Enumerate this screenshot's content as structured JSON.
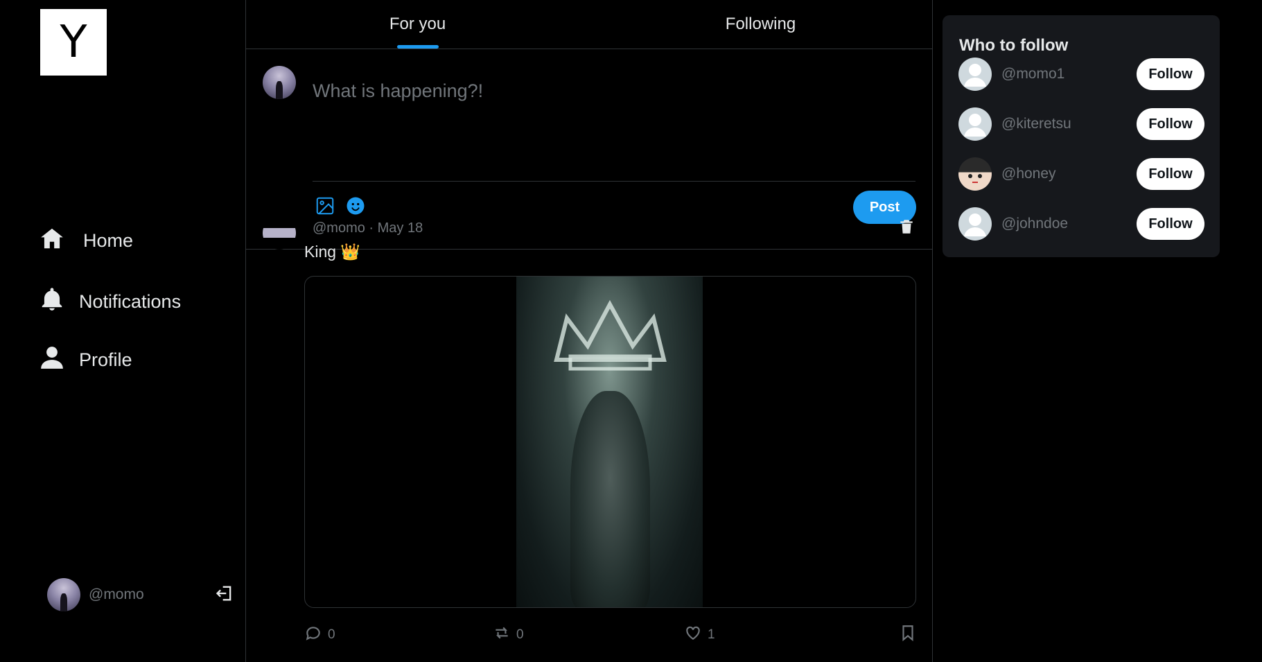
{
  "logo": {
    "letter": "Y"
  },
  "sidebar": {
    "items": [
      {
        "label": "Home",
        "icon": "home-icon"
      },
      {
        "label": "Notifications",
        "icon": "bell-icon"
      },
      {
        "label": "Profile",
        "icon": "user-icon"
      }
    ],
    "account": {
      "handle": "@momo",
      "icon": "logout-icon"
    }
  },
  "tabs": [
    {
      "label": "For you",
      "active": true
    },
    {
      "label": "Following",
      "active": false
    }
  ],
  "composer": {
    "placeholder": "What is happening?!",
    "post_label": "Post",
    "tools": [
      "image-icon",
      "emoji-icon"
    ]
  },
  "tweet": {
    "handle": "@momo",
    "separator": "·",
    "date": "May 18",
    "meta": "@momo · May 18",
    "text": "King 👑",
    "stats": {
      "replies": "0",
      "reposts": "0",
      "likes": "1"
    }
  },
  "who_to_follow": {
    "title": "Who to follow",
    "users": [
      {
        "handle": "@momo1",
        "button": "Follow"
      },
      {
        "handle": "@kiteretsu",
        "button": "Follow"
      },
      {
        "handle": "@honey",
        "button": "Follow"
      },
      {
        "handle": "@johndoe",
        "button": "Follow"
      }
    ]
  },
  "colors": {
    "accent": "#1d9bf0",
    "background": "#000000",
    "panel": "#16181c",
    "muted": "#71767b"
  }
}
